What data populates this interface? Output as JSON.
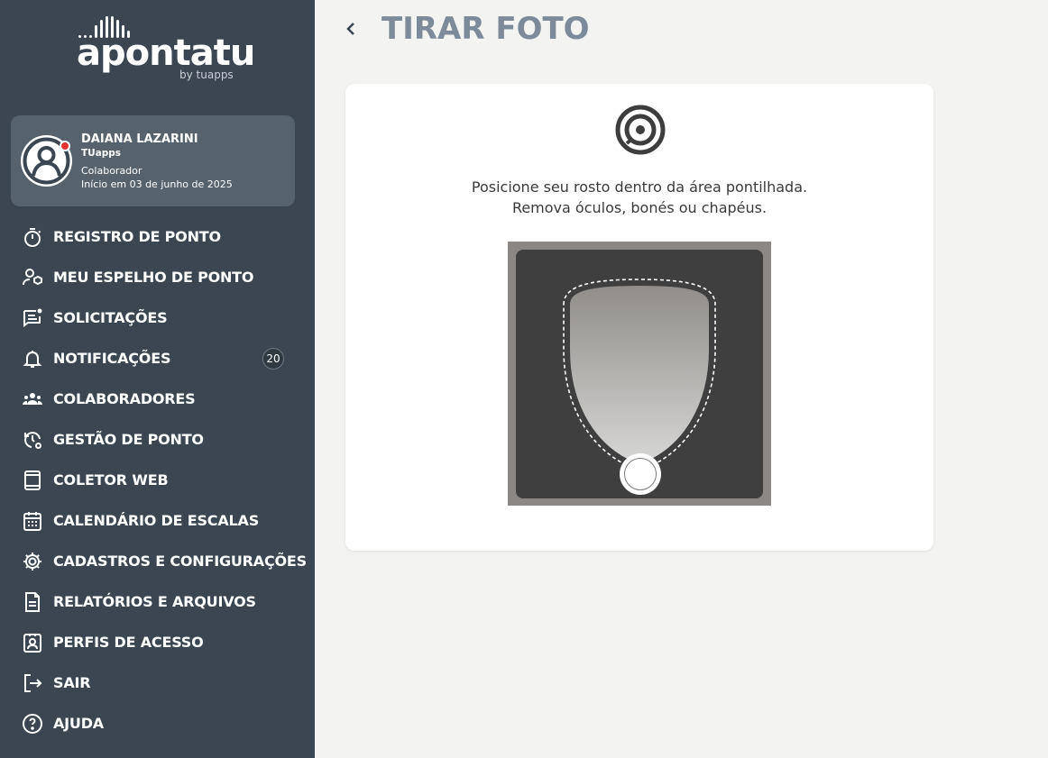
{
  "brand": {
    "name": "apontatu",
    "byline": "by tuapps"
  },
  "user": {
    "name": "DAIANA LAZARINI",
    "company": "TUapps",
    "role": "Colaborador",
    "start": "Início em 03 de junho de 2025"
  },
  "nav": [
    {
      "label": "REGISTRO DE PONTO",
      "icon": "stopwatch-icon"
    },
    {
      "label": "MEU ESPELHO DE PONTO",
      "icon": "user-clipboard-icon"
    },
    {
      "label": "SOLICITAÇÕES",
      "icon": "chat-request-icon"
    },
    {
      "label": "NOTIFICAÇÕES",
      "icon": "bell-icon",
      "badge": "20"
    },
    {
      "label": "COLABORADORES",
      "icon": "team-icon"
    },
    {
      "label": "GESTÃO DE PONTO",
      "icon": "clock-gear-icon"
    },
    {
      "label": "COLETOR WEB",
      "icon": "tablet-icon"
    },
    {
      "label": "CALENDÁRIO DE ESCALAS",
      "icon": "calendar-icon"
    },
    {
      "label": "CADASTROS E CONFIGURAÇÕES",
      "icon": "gear-icon"
    },
    {
      "label": "RELATÓRIOS E ARQUIVOS",
      "icon": "document-icon"
    },
    {
      "label": "PERFIS DE ACESSO",
      "icon": "badge-user-icon"
    },
    {
      "label": "SAIR",
      "icon": "logout-icon"
    },
    {
      "label": "AJUDA",
      "icon": "help-icon"
    }
  ],
  "page": {
    "title": "TIRAR FOTO",
    "instruction_line1": "Posicione seu rosto dentro da área pontilhada.",
    "instruction_line2": "Remova óculos, bonés ou chapéus."
  },
  "colors": {
    "sidebar": "#3b4652",
    "user_card": "#56626e",
    "title": "#7c8a99",
    "accent_dot": "#e63131"
  }
}
